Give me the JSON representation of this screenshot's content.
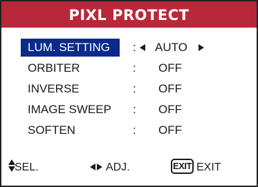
{
  "menu": {
    "title": "PIXL PROTECT",
    "items": [
      {
        "label": "LUM. SETTING",
        "colon": ":",
        "value": "AUTO"
      },
      {
        "label": "ORBITER",
        "colon": ":",
        "value": "OFF"
      },
      {
        "label": "INVERSE",
        "colon": ":",
        "value": "OFF"
      },
      {
        "label": "IMAGE SWEEP",
        "colon": ":",
        "value": "OFF"
      },
      {
        "label": "SOFTEN",
        "colon": ":",
        "value": "OFF"
      }
    ],
    "selected_index": 0
  },
  "footer": {
    "sel_label": "SEL.",
    "adj_label": "ADJ.",
    "exit_key": "EXIT",
    "exit_label": "EXIT",
    "sel_icon": "up-down-triangle-icon",
    "adj_icon": "left-right-triangle-icon"
  },
  "colors": {
    "header_bg": "#b8283a",
    "selected_bg": "#0b2a8a",
    "text": "#1a1a1a"
  }
}
